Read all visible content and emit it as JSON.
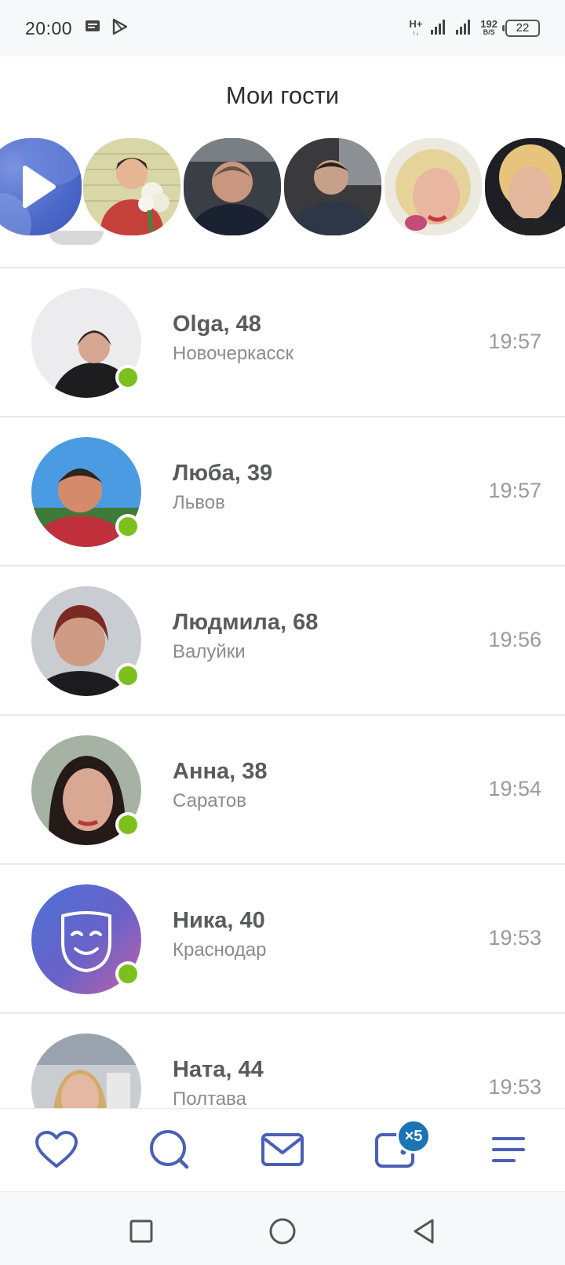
{
  "status_bar": {
    "time": "20:00",
    "network_type": "H+",
    "network_sub": "↑↓",
    "speed_value": "192",
    "speed_unit": "B/S",
    "battery": "22"
  },
  "header": {
    "title": "Мои гости"
  },
  "story_strip": {
    "items": [
      {
        "kind": "play-button",
        "icon": "play-icon"
      },
      {
        "kind": "photo"
      },
      {
        "kind": "photo"
      },
      {
        "kind": "photo"
      },
      {
        "kind": "photo"
      },
      {
        "kind": "photo"
      }
    ]
  },
  "guests": [
    {
      "name": "Olga, 48",
      "city": "Новочеркасск",
      "time": "19:57",
      "online": true
    },
    {
      "name": "Люба, 39",
      "city": "Львов",
      "time": "19:57",
      "online": true
    },
    {
      "name": "Людмила, 68",
      "city": "Валуйки",
      "time": "19:56",
      "online": true
    },
    {
      "name": "Анна, 38",
      "city": "Саратов",
      "time": "19:54",
      "online": true
    },
    {
      "name": "Ника, 40",
      "city": "Краснодар",
      "time": "19:53",
      "online": true
    },
    {
      "name": "Ната, 44",
      "city": "Полтава",
      "time": "19:53",
      "online": false
    }
  ],
  "bottom_nav": {
    "items": [
      {
        "icon": "heart-icon"
      },
      {
        "icon": "search-icon"
      },
      {
        "icon": "mail-icon"
      },
      {
        "icon": "wallet-icon",
        "badge": "×5"
      },
      {
        "icon": "menu-icon"
      }
    ]
  },
  "colors": {
    "accent": "#4a5fb5",
    "online": "#7dc01e",
    "badge": "#1b74b4"
  }
}
